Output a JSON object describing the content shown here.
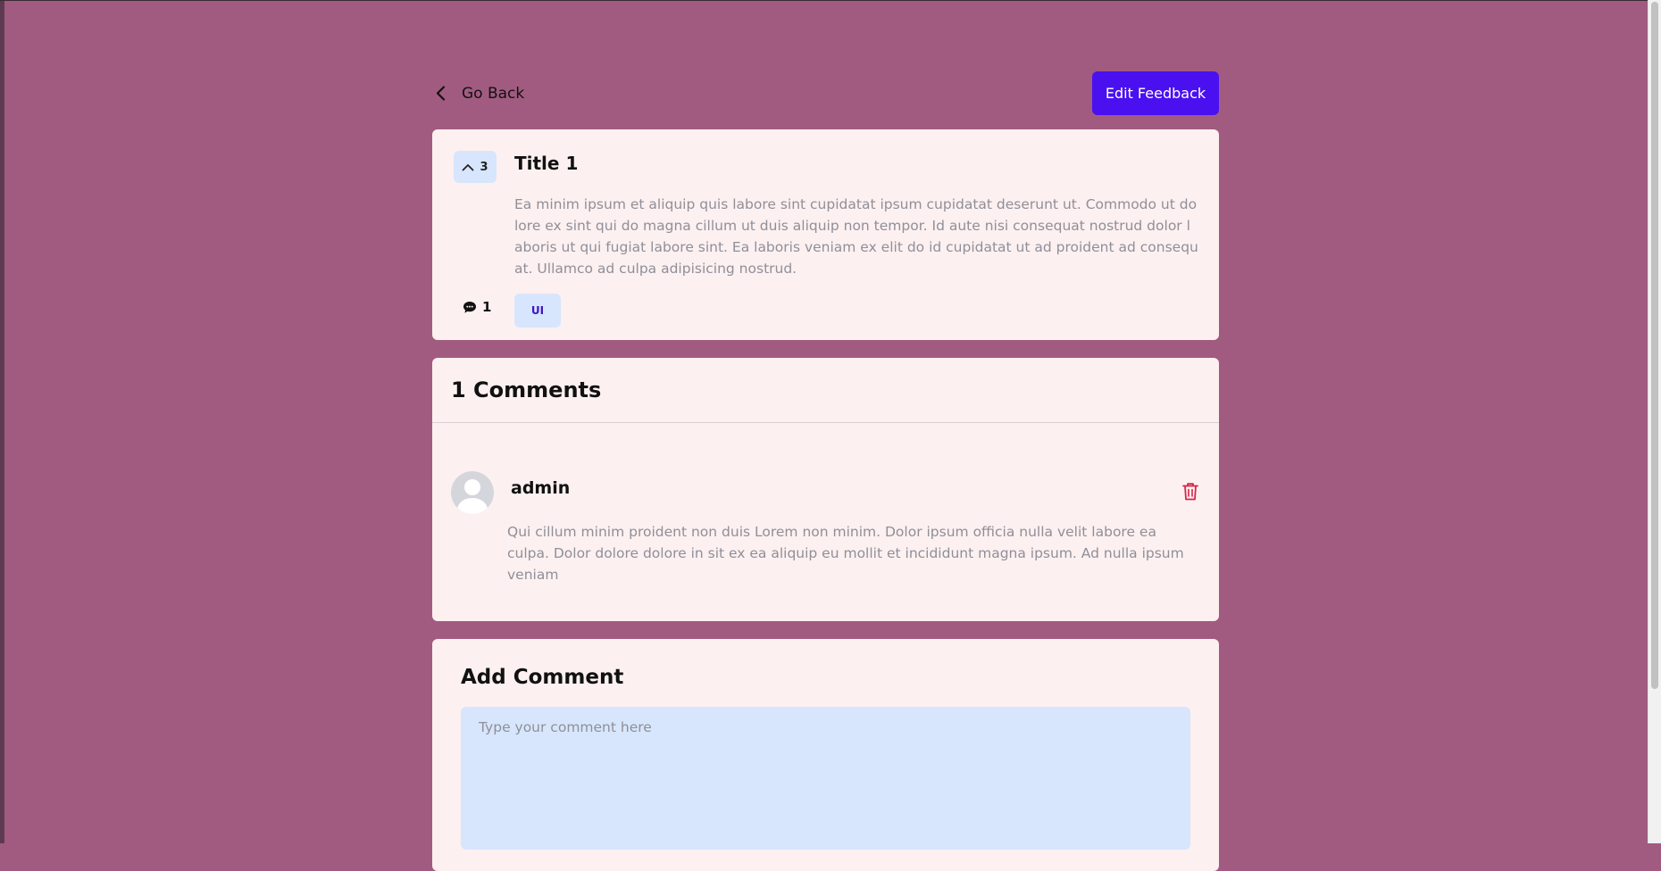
{
  "nav": {
    "go_back_label": "Go Back",
    "edit_label": "Edit Feedback"
  },
  "feedback": {
    "upvotes": "3",
    "title": "Title 1",
    "description": "Ea minim ipsum et aliquip quis labore sint cupidatat ipsum cupidatat deserunt ut. Commodo ut dolore ex sint qui do magna cillum ut duis aliquip non tempor. Id aute nisi consequat nostrud dolor laboris ut qui fugiat labore sint. Ea laboris veniam ex elit do id cupidatat ut ad proident ad consequat. Ullamco ad culpa adipisicing nostrud.",
    "comment_count": "1",
    "tag": "UI"
  },
  "comments": {
    "heading": "1 Comments",
    "items": [
      {
        "author": "admin",
        "text": "Qui cillum minim proident non duis Lorem non minim. Dolor ipsum officia nulla velit labore ea culpa. Dolor dolore dolore in sit ex ea aliquip eu mollit et incididunt magna ipsum. Ad nulla ipsum veniam"
      }
    ]
  },
  "add_comment": {
    "heading": "Add Comment",
    "placeholder": "Type your comment here"
  },
  "colors": {
    "background": "#a25b80",
    "card": "#fdf0f0",
    "accent": "#4a10f0",
    "chip": "#d7e6fc",
    "delete": "#d6254a"
  }
}
